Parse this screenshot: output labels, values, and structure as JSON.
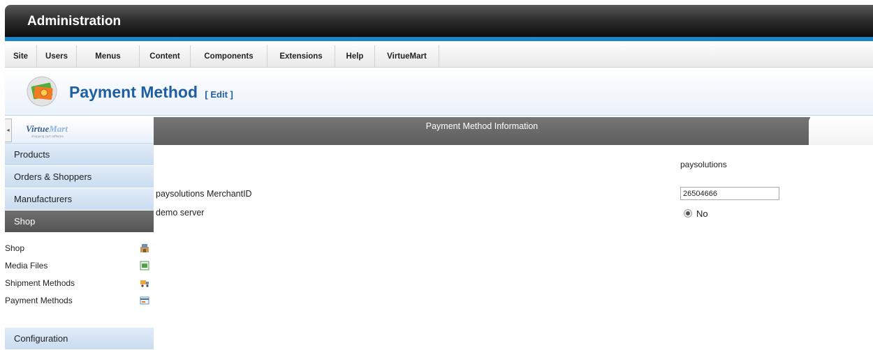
{
  "header": {
    "title": "Administration"
  },
  "menu": {
    "items": [
      "Site",
      "Users",
      "Menus",
      "Content",
      "Components",
      "Extensions",
      "Help",
      "VirtueMart"
    ]
  },
  "page": {
    "title": "Payment Method",
    "subtitle": "[ Edit ]"
  },
  "sidebar": {
    "logo_text": "VirtueMart",
    "logo_tagline": "shopping cart software",
    "sections": {
      "products": "Products",
      "orders": "Orders & Shoppers",
      "manufacturers": "Manufacturers",
      "shop": "Shop",
      "configuration": "Configuration"
    },
    "shop_links": [
      {
        "label": "Shop",
        "icon": "shop-icon"
      },
      {
        "label": "Media Files",
        "icon": "media-icon"
      },
      {
        "label": "Shipment Methods",
        "icon": "truck-icon"
      },
      {
        "label": "Payment Methods",
        "icon": "payment-icon"
      }
    ]
  },
  "content": {
    "section_title": "Payment Method Information",
    "plugin_name": "paysolutions",
    "fields": {
      "merchant_label": "paysolutions MerchantID",
      "merchant_value": "26504666",
      "demo_label": "demo server",
      "demo_option": "No"
    }
  },
  "colors": {
    "accent": "#1a85c8",
    "title": "#1f5fa1",
    "active_section": "#5e5e5e"
  }
}
